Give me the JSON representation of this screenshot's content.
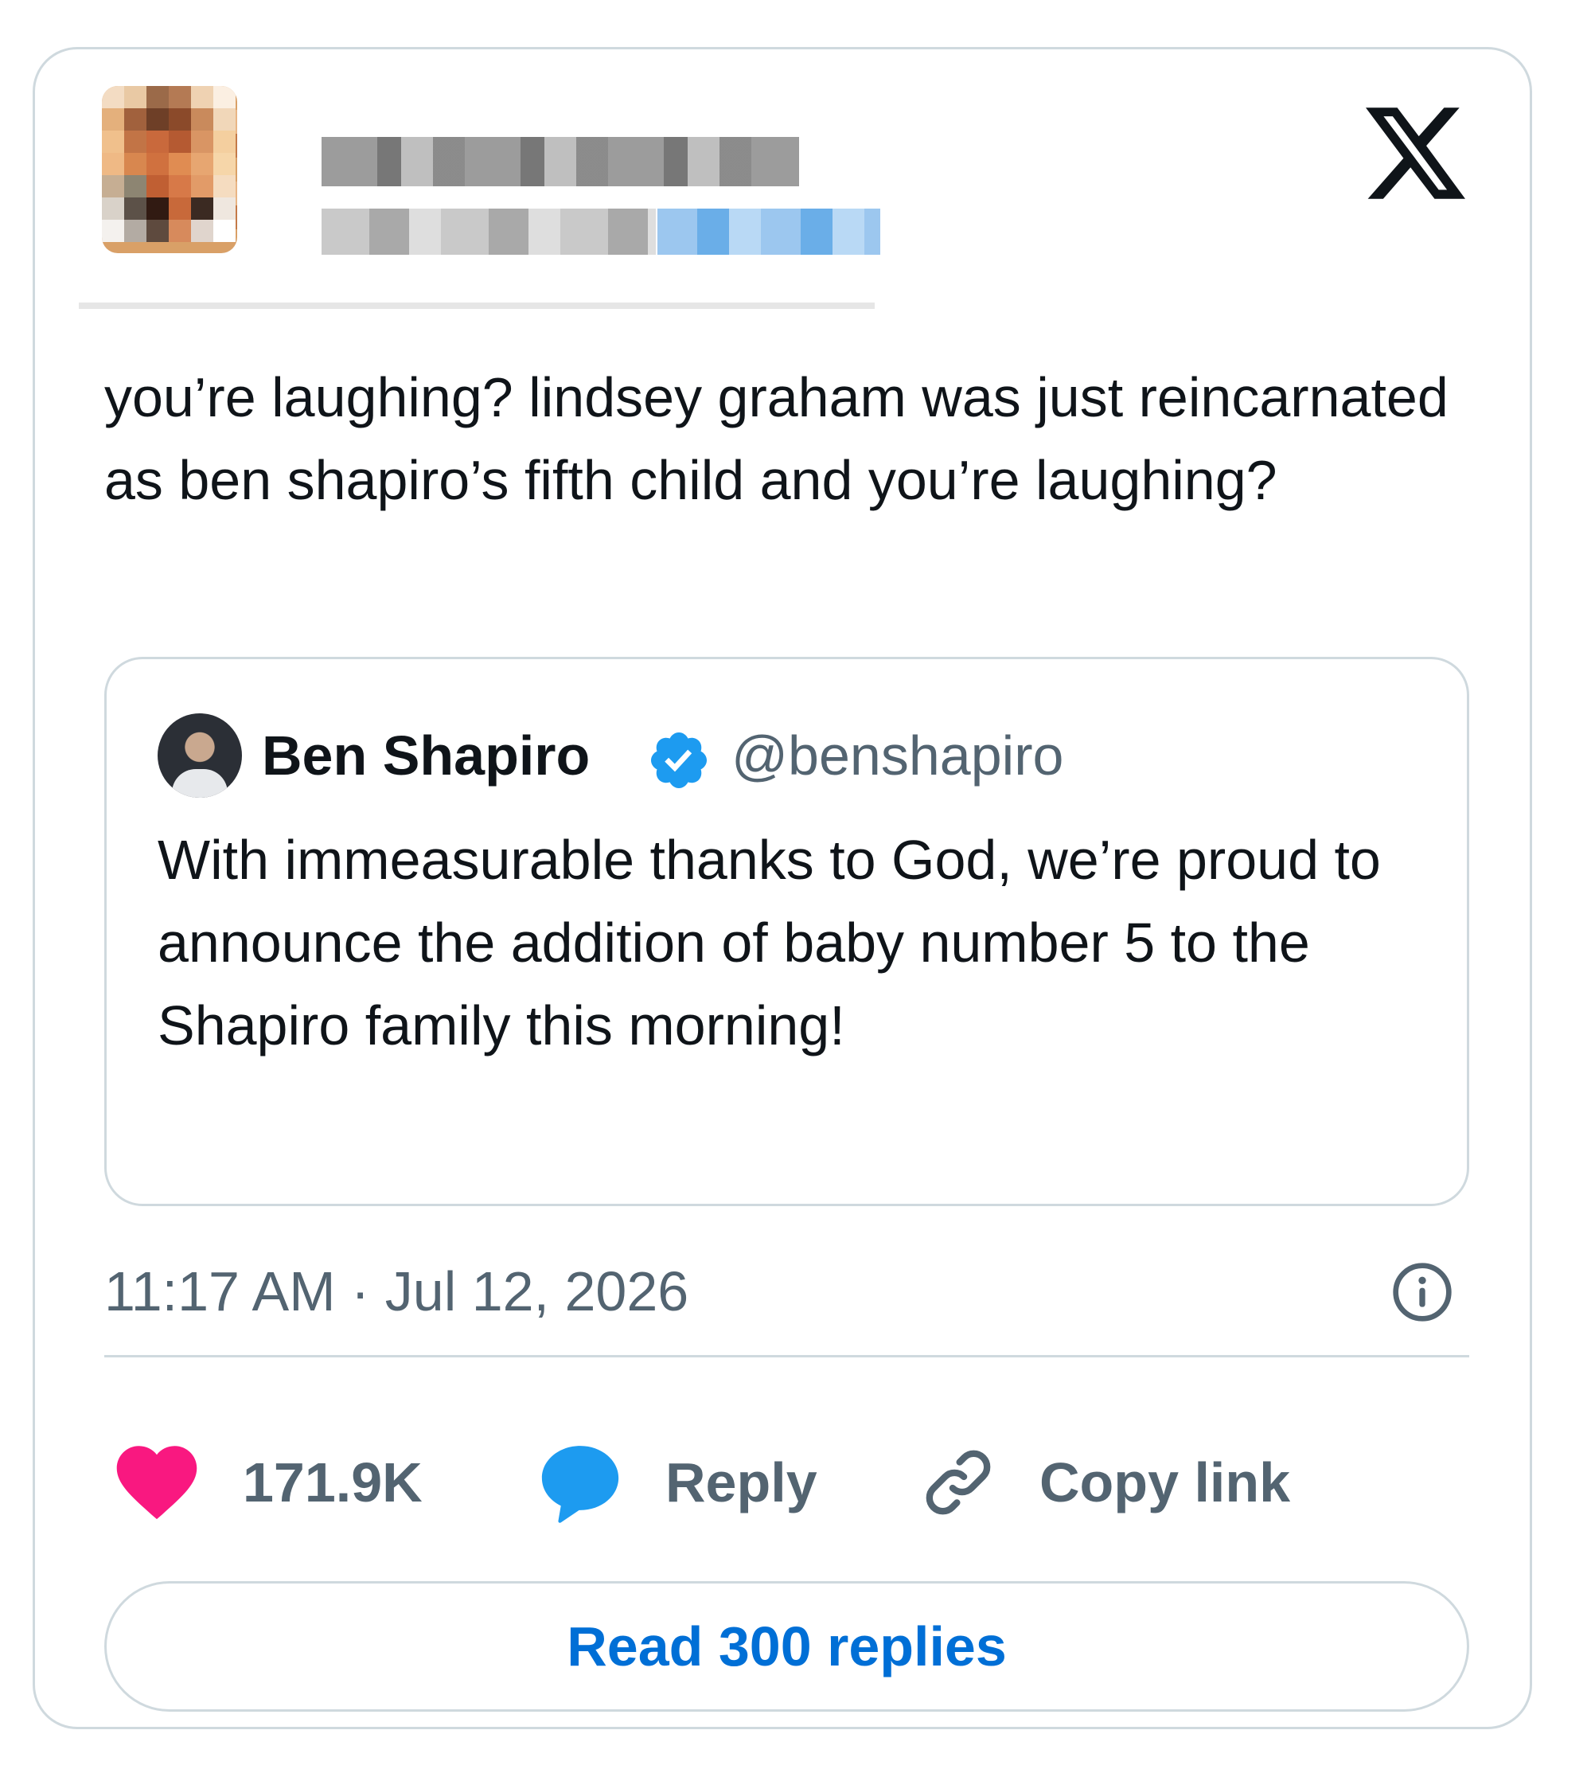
{
  "brand": {
    "logo_icon": "x-logo-icon",
    "text_color": "#0f1419",
    "muted_color": "#536471",
    "link_color": "#006fd6",
    "like_color": "#f91880",
    "reply_color": "#1d9bf0",
    "border_color": "#cfd9de"
  },
  "author": {
    "avatar": "blurred",
    "name": "",
    "handle": ""
  },
  "tweet": {
    "text": "you’re laughing? lindsey graham was just reincarnated as ben shapiro’s fifth child and you’re laughing?"
  },
  "quoted_tweet": {
    "name": "Ben Shapiro",
    "verified_icon": "verified-badge-icon",
    "handle": "@benshapiro",
    "text": "With immeasurable thanks to God, we’re proud to announce the addition of baby number 5 to the Shapiro family this morning!"
  },
  "meta": {
    "timestamp": "11:17 AM · Jul 12, 2026",
    "info_icon": "info-icon"
  },
  "actions": {
    "likes_count": "171.9K",
    "reply_label": "Reply",
    "copy_link_label": "Copy link"
  },
  "footer": {
    "read_replies_label": "Read 300 replies"
  }
}
